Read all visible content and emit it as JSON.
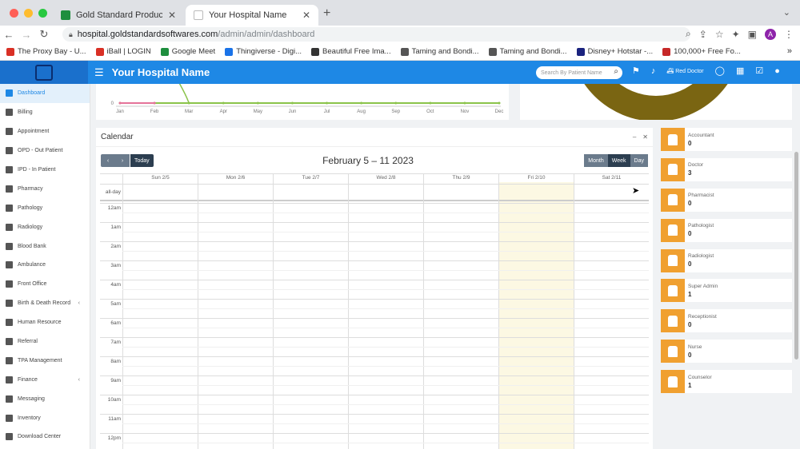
{
  "browser": {
    "tabs": [
      {
        "title": "Gold Standard Products - Go",
        "favicon_color": "#1e8e3e",
        "active": false
      },
      {
        "title": "Your Hospital Name",
        "favicon_color": "#bbbbbb",
        "active": true
      }
    ],
    "url_host": "hospital.goldstandardsoftwares.com",
    "url_path": "/admin/admin/dashboard",
    "profile_initial": "A",
    "bookmarks": [
      {
        "label": "The Proxy Bay - U...",
        "color": "#d93025"
      },
      {
        "label": "iBall | LOGIN",
        "color": "#d93025"
      },
      {
        "label": "Google Meet",
        "color": "#1e8e3e"
      },
      {
        "label": "Thingiverse - Digi...",
        "color": "#1a73e8"
      },
      {
        "label": "Beautiful Free Ima...",
        "color": "#333333"
      },
      {
        "label": "Taming and Bondi...",
        "color": "#555555"
      },
      {
        "label": "Taming and Bondi...",
        "color": "#555555"
      },
      {
        "label": "Disney+ Hotstar -...",
        "color": "#1a237e"
      },
      {
        "label": "100,000+ Free Fo...",
        "color": "#c62828"
      }
    ],
    "more_bookmarks": "»"
  },
  "header": {
    "title": "Your Hospital Name",
    "search_placeholder": "Search By Patient Name",
    "user_name": "Red Doctor",
    "accent": "#1e88e5"
  },
  "sidebar": {
    "items": [
      {
        "label": "Dashboard",
        "active": true,
        "arrow": ""
      },
      {
        "label": "Billing",
        "arrow": ""
      },
      {
        "label": "Appointment",
        "arrow": ""
      },
      {
        "label": "OPD - Out Patient",
        "arrow": ""
      },
      {
        "label": "IPD - In Patient",
        "arrow": ""
      },
      {
        "label": "Pharmacy",
        "arrow": ""
      },
      {
        "label": "Pathology",
        "arrow": ""
      },
      {
        "label": "Radiology",
        "arrow": ""
      },
      {
        "label": "Blood Bank",
        "arrow": ""
      },
      {
        "label": "Ambulance",
        "arrow": ""
      },
      {
        "label": "Front Office",
        "arrow": ""
      },
      {
        "label": "Birth & Death Record",
        "arrow": "‹"
      },
      {
        "label": "Human Resource",
        "arrow": ""
      },
      {
        "label": "Referral",
        "arrow": ""
      },
      {
        "label": "TPA Management",
        "arrow": ""
      },
      {
        "label": "Finance",
        "arrow": "‹"
      },
      {
        "label": "Messaging",
        "arrow": ""
      },
      {
        "label": "Inventory",
        "arrow": ""
      },
      {
        "label": "Download Center",
        "arrow": ""
      }
    ]
  },
  "chart_data": {
    "type": "line",
    "categories": [
      "Jan",
      "Feb",
      "Mar",
      "Apr",
      "May",
      "Jun",
      "Jul",
      "Aug",
      "Sep",
      "Oct",
      "Nov",
      "Dec"
    ],
    "series": [
      {
        "values": [
          0,
          0,
          0,
          0,
          0,
          0,
          0,
          0,
          0,
          0,
          0,
          0
        ],
        "color": "#8bc34a"
      },
      {
        "values": [
          0,
          0,
          null,
          null,
          null,
          null,
          null,
          null,
          null,
          null,
          null,
          null
        ],
        "color": "#e57399"
      }
    ],
    "donut_color": "#7a6512"
  },
  "calendar": {
    "title": "Calendar",
    "range": "February 5 – 11 2023",
    "today_label": "Today",
    "prev": "‹",
    "next": "›",
    "views": [
      "Month",
      "Week",
      "Day"
    ],
    "active_view": "Week",
    "days": [
      "Sun 2/5",
      "Mon 2/6",
      "Tue 2/7",
      "Wed 2/8",
      "Thu 2/9",
      "Fri 2/10",
      "Sat 2/11"
    ],
    "today_index": 5,
    "allday_label": "all-day",
    "times": [
      "12am",
      "1am",
      "2am",
      "3am",
      "4am",
      "5am",
      "6am",
      "7am",
      "8am",
      "9am",
      "10am",
      "11am",
      "12pm"
    ]
  },
  "staff_cards": [
    {
      "role": "Accountant",
      "count": "0"
    },
    {
      "role": "Doctor",
      "count": "3"
    },
    {
      "role": "Pharmacist",
      "count": "0"
    },
    {
      "role": "Pathologist",
      "count": "0"
    },
    {
      "role": "Radiologist",
      "count": "0"
    },
    {
      "role": "Super Admin",
      "count": "1"
    },
    {
      "role": "Receptionist",
      "count": "0"
    },
    {
      "role": "Nurse",
      "count": "0"
    },
    {
      "role": "Counselor",
      "count": "1"
    }
  ],
  "staff_card_color": "#f0a030"
}
